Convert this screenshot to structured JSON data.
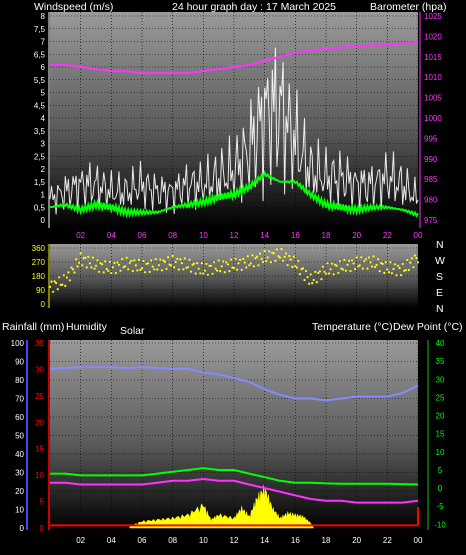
{
  "colors": {
    "wind_avg": "#00ff00",
    "wind_gust": "#ffffff",
    "barometer": "#ff33ff",
    "direction": "#ffff00",
    "temperature": "#00ff00",
    "dewpoint": "#ff33ff",
    "humidity": "#8888ff",
    "solar": "#ffff00",
    "rainfall": "#ff0000",
    "humidity_axis": "#4444ff",
    "rain_axis": "#cc0000",
    "temp_axis": "#00cc00"
  },
  "header": {
    "wind_label": "Windspeed (m/s)",
    "title": "24 hour graph day : 17 March 2025",
    "baro_label": "Barometer (hpa)"
  },
  "lower_header": {
    "rain_label": "Rainfall (mm)",
    "humidity_label": "Humidity",
    "solar_label": "Solar",
    "temp_label": "Temperature (°C)",
    "dew_label": "Dew Point (°C)"
  },
  "compass": [
    "N",
    "W",
    "S",
    "E",
    "N"
  ],
  "chart_data": [
    {
      "type": "line",
      "title": "24 hour graph day : 17 March 2025",
      "x_ticks": [
        "02",
        "04",
        "06",
        "08",
        "10",
        "12",
        "14",
        "16",
        "18",
        "20",
        "22",
        "00"
      ],
      "ylabel_left": "Windspeed (m/s)",
      "y_left_ticks": [
        "0",
        "0,5",
        "1",
        "1,5",
        "2",
        "2,5",
        "3",
        "3,5",
        "4",
        "4,5",
        "5",
        "5,5",
        "6",
        "6,5",
        "7",
        "7,5",
        "8"
      ],
      "ylim_left": [
        0,
        8.5
      ],
      "ylabel_right": "Barometer (hpa)",
      "y_right_ticks": [
        "975",
        "980",
        "985",
        "990",
        "995",
        "1000",
        "1005",
        "1010",
        "1015",
        "1020",
        "1025"
      ],
      "ylim_right": [
        974,
        1026
      ],
      "series": [
        {
          "name": "Windspeed",
          "x": [
            0,
            1,
            2,
            3,
            4,
            5,
            6,
            7,
            8,
            9,
            10,
            11,
            12,
            13,
            14,
            15,
            16,
            17,
            18,
            19,
            20,
            21,
            22,
            23,
            24
          ],
          "values": [
            0.5,
            0.6,
            0.4,
            0.6,
            0.5,
            0.3,
            0.3,
            0.3,
            0.5,
            0.6,
            0.7,
            0.9,
            1.0,
            1.3,
            1.8,
            1.5,
            1.5,
            1.0,
            0.6,
            0.5,
            0.4,
            0.5,
            0.5,
            0.4,
            0.2
          ]
        },
        {
          "name": "Gust",
          "x": [
            0,
            1,
            2,
            3,
            4,
            5,
            6,
            7,
            8,
            9,
            10,
            11,
            12,
            13,
            14,
            15,
            16,
            17,
            18,
            19,
            20,
            21,
            22,
            23,
            24
          ],
          "values": [
            1.5,
            2.0,
            2.5,
            2.5,
            2.0,
            2.0,
            2.5,
            2.0,
            2.0,
            2.5,
            2.5,
            3.0,
            3.5,
            5.0,
            7.5,
            8.0,
            5.5,
            3.5,
            3.0,
            3.0,
            2.5,
            2.5,
            3.0,
            2.5,
            1.5
          ]
        },
        {
          "name": "Barometer",
          "x": [
            0,
            1,
            2,
            3,
            4,
            5,
            6,
            7,
            8,
            9,
            10,
            11,
            12,
            13,
            14,
            15,
            16,
            17,
            18,
            19,
            20,
            21,
            22,
            23,
            24
          ],
          "values": [
            1013,
            1013,
            1012.5,
            1012,
            1011.5,
            1011.5,
            1011,
            1011,
            1011,
            1011,
            1011.5,
            1012,
            1012.5,
            1013,
            1014,
            1015,
            1016,
            1016.5,
            1017,
            1017.3,
            1017.5,
            1017.8,
            1018,
            1018.3,
            1018.6
          ]
        }
      ]
    },
    {
      "type": "scatter",
      "x_ticks": [
        "02",
        "04",
        "06",
        "08",
        "10",
        "12",
        "14",
        "16",
        "18",
        "20",
        "22",
        "00"
      ],
      "y_ticks": [
        "0",
        "90",
        "180",
        "270",
        "360"
      ],
      "ylim": [
        0,
        360
      ],
      "series": [
        {
          "name": "Wind direction",
          "x": [
            0,
            1,
            2,
            3,
            4,
            5,
            6,
            7,
            8,
            9,
            10,
            11,
            12,
            13,
            14,
            15,
            16,
            17,
            18,
            19,
            20,
            21,
            22,
            23,
            24
          ],
          "values": [
            110,
            150,
            290,
            250,
            230,
            260,
            240,
            250,
            270,
            250,
            220,
            240,
            250,
            270,
            300,
            320,
            260,
            150,
            220,
            240,
            260,
            270,
            230,
            220,
            300
          ]
        }
      ]
    },
    {
      "type": "line",
      "x_ticks": [
        "02",
        "04",
        "06",
        "08",
        "10",
        "12",
        "14",
        "16",
        "18",
        "20",
        "22",
        "00"
      ],
      "y_humidity_ticks": [
        "0",
        "10",
        "20",
        "30",
        "40",
        "50",
        "60",
        "70",
        "80",
        "90",
        "100"
      ],
      "ylim_humidity": [
        0,
        100
      ],
      "y_rain_ticks": [
        "0",
        "5",
        "10",
        "15",
        "20",
        "25",
        "30",
        "35"
      ],
      "ylim_rain": [
        0,
        35
      ],
      "y_temp_ticks": [
        "-10",
        "-5",
        "0",
        "5",
        "10",
        "15",
        "20",
        "25",
        "30",
        "35",
        "40"
      ],
      "ylim_temp": [
        -11,
        40
      ],
      "series": [
        {
          "name": "Humidity",
          "x": [
            0,
            1,
            2,
            3,
            4,
            5,
            6,
            7,
            8,
            9,
            10,
            11,
            12,
            13,
            14,
            15,
            16,
            17,
            18,
            19,
            20,
            21,
            22,
            23,
            24
          ],
          "values": [
            86,
            86.5,
            87,
            87,
            87,
            86.5,
            87,
            86.5,
            86,
            86,
            84,
            83,
            81,
            79,
            75,
            72,
            70,
            70,
            69,
            70,
            71,
            71,
            71,
            73,
            77
          ]
        },
        {
          "name": "Temperature",
          "x": [
            0,
            1,
            2,
            3,
            4,
            5,
            6,
            7,
            8,
            9,
            10,
            11,
            12,
            13,
            14,
            15,
            16,
            17,
            18,
            19,
            20,
            21,
            22,
            23,
            24
          ],
          "values": [
            4,
            4,
            3.5,
            3.5,
            3.5,
            3.5,
            3.5,
            4,
            4.5,
            5,
            5.5,
            5,
            5,
            4,
            3,
            2,
            1.5,
            1.5,
            1.3,
            1.2,
            1.2,
            1.2,
            1.2,
            1.1,
            1
          ]
        },
        {
          "name": "Dew Point",
          "x": [
            0,
            1,
            2,
            3,
            4,
            5,
            6,
            7,
            8,
            9,
            10,
            11,
            12,
            13,
            14,
            15,
            16,
            17,
            18,
            19,
            20,
            21,
            22,
            23,
            24
          ],
          "values": [
            1.5,
            1.5,
            1,
            1,
            1,
            1,
            1,
            1.5,
            2,
            2,
            2.5,
            2,
            2,
            1,
            0,
            -1,
            -2,
            -3,
            -3.5,
            -3.5,
            -4,
            -4,
            -4,
            -4,
            -3.5
          ]
        },
        {
          "name": "Solar",
          "x": [
            5.2,
            6,
            7,
            8,
            9,
            10,
            10.5,
            11,
            12,
            12.5,
            13,
            13.5,
            14,
            14.5,
            15,
            15.5,
            16,
            16.5,
            17,
            17.2
          ],
          "values": [
            1,
            4,
            5,
            6,
            8,
            14,
            5,
            8,
            6,
            12,
            7,
            18,
            24,
            12,
            6,
            9,
            8,
            7,
            3,
            0
          ]
        },
        {
          "name": "Rainfall",
          "x": [
            0,
            24
          ],
          "values": [
            0.5,
            0.5
          ]
        }
      ]
    }
  ]
}
